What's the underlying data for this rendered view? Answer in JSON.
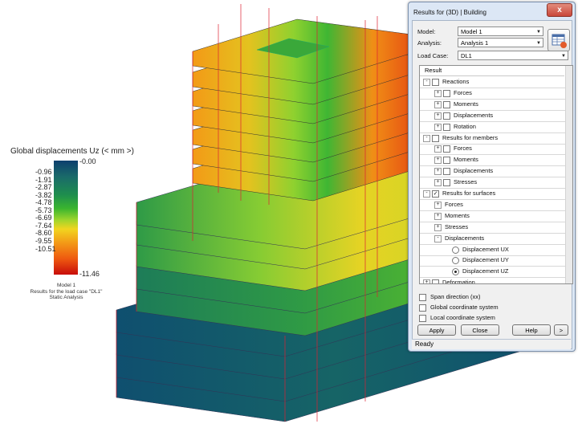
{
  "legend": {
    "title": "Global displacements Uz (< mm >)",
    "top_value": "-0.00",
    "bottom_value": "-11.46",
    "ticks": [
      "-0.96",
      "-1.91",
      "-2.87",
      "-3.82",
      "-4.78",
      "-5.73",
      "-6.69",
      "-7.64",
      "-8.60",
      "-9.55",
      "-10.51"
    ],
    "caption": [
      "Model 1",
      "Results for the load case \"DL1\"",
      "Static Analysis"
    ]
  },
  "dialog": {
    "title": "Results for (3D) | Building",
    "close_label": "x",
    "model_label": "Model:",
    "model_value": "Model 1",
    "analysis_label": "Analysis:",
    "analysis_value": "Analysis 1",
    "loadcase_label": "Load Case:",
    "loadcase_value": "DL1",
    "tree_header": "Result",
    "tree": [
      {
        "label": "Reactions",
        "level": 0,
        "expander": "-",
        "checked": false
      },
      {
        "label": "Forces",
        "level": 1,
        "expander": "+",
        "checked": false
      },
      {
        "label": "Moments",
        "level": 1,
        "expander": "+",
        "checked": false
      },
      {
        "label": "Displacements",
        "level": 1,
        "expander": "+",
        "checked": false
      },
      {
        "label": "Rotation",
        "level": 1,
        "expander": "+",
        "checked": false
      },
      {
        "label": "Results for members",
        "level": 0,
        "expander": "-",
        "checked": false
      },
      {
        "label": "Forces",
        "level": 1,
        "expander": "+",
        "checked": false
      },
      {
        "label": "Moments",
        "level": 1,
        "expander": "+",
        "checked": false
      },
      {
        "label": "Displacements",
        "level": 1,
        "expander": "+",
        "checked": false
      },
      {
        "label": "Stresses",
        "level": 1,
        "expander": "+",
        "checked": false
      },
      {
        "label": "Results for surfaces",
        "level": 0,
        "expander": "-",
        "checked": true
      },
      {
        "label": "Forces",
        "level": 1,
        "expander": "+",
        "checked": null
      },
      {
        "label": "Moments",
        "level": 1,
        "expander": "+",
        "checked": null
      },
      {
        "label": "Stresses",
        "level": 1,
        "expander": "+",
        "checked": null
      },
      {
        "label": "Displacements",
        "level": 1,
        "expander": "-",
        "checked": null
      },
      {
        "label": "Displacement UX",
        "level": 2,
        "radio": false
      },
      {
        "label": "Displacement UY",
        "level": 2,
        "radio": false
      },
      {
        "label": "Displacement UZ",
        "level": 2,
        "radio": true
      },
      {
        "label": "Deformation",
        "level": 0,
        "expander": "+",
        "checked": false
      }
    ],
    "options": [
      {
        "label": "Span direction (xx)",
        "checked": false
      },
      {
        "label": "Global coordinate system",
        "checked": false
      },
      {
        "label": "Local coordinate system",
        "checked": false
      }
    ],
    "buttons": {
      "apply": "Apply",
      "close": "Close",
      "help": "Help",
      "more": ">"
    },
    "status": "Ready"
  },
  "colors": {
    "dark_blue": "#0d3f6e",
    "teal": "#1a6a6a",
    "green": "#2aa43a",
    "yellow": "#f1d51f",
    "orange": "#f39a17",
    "red": "#c80d0a",
    "dialog_frame": "#dce7f5"
  }
}
